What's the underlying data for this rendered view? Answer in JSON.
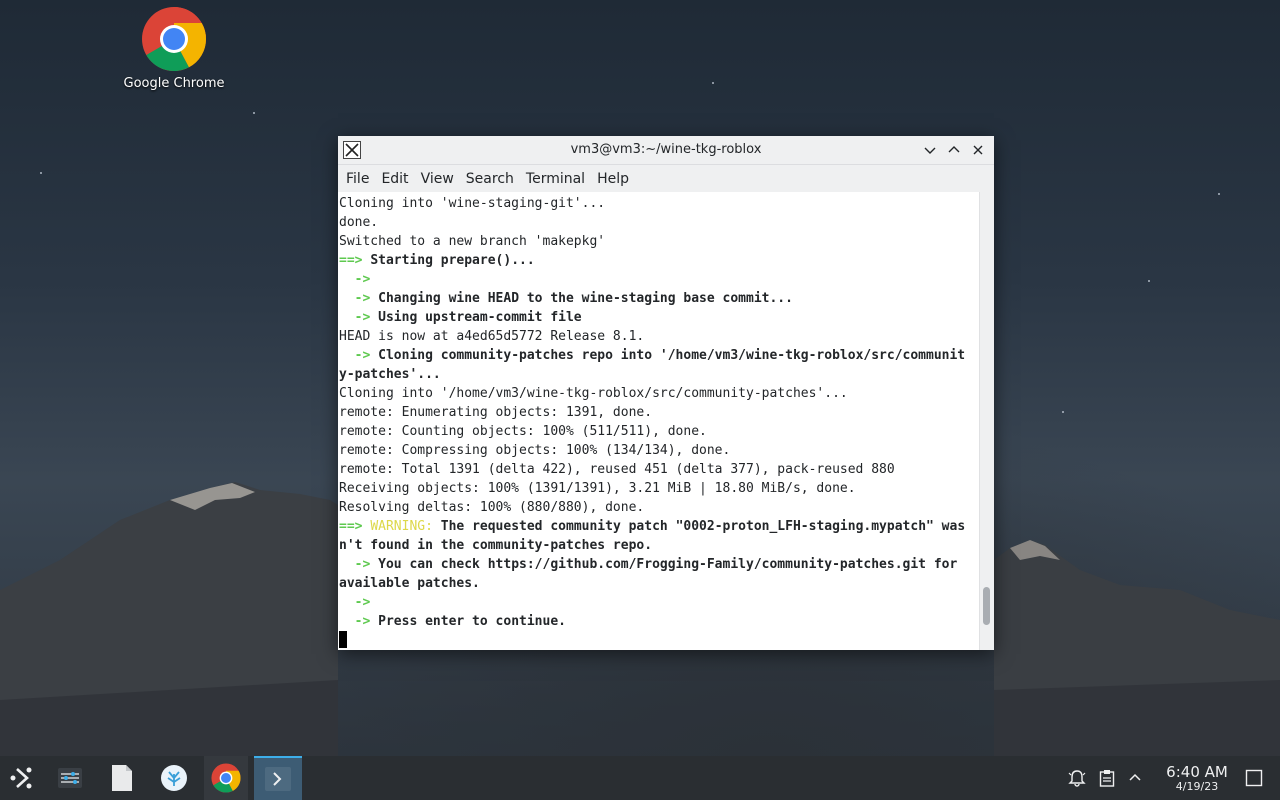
{
  "desktop": {
    "icons": [
      {
        "label": "Google Chrome",
        "icon": "chrome-icon"
      }
    ]
  },
  "window": {
    "title": "vm3@vm3:~/wine-tkg-roblox",
    "menu": [
      "File",
      "Edit",
      "View",
      "Search",
      "Terminal",
      "Help"
    ],
    "buttons": [
      "minimize-icon",
      "maximize-icon",
      "close-icon"
    ]
  },
  "terminal": {
    "lines": [
      "Cloning into 'wine-staging-git'...",
      "done.",
      "Switched to a new branch 'makepkg'",
      "Starting prepare()...",
      "  -> Changing wine HEAD to the wine-staging base commit...",
      "  -> Using upstream-commit file",
      "HEAD is now at a4ed65d5772 Release 8.1.",
      "  -> Cloning community-patches repo into '/home/vm3/wine-tkg-roblox/src/communit",
      "y-patches'...",
      "Cloning into '/home/vm3/wine-tkg-roblox/src/community-patches'...",
      "remote: Enumerating objects: 1391, done.",
      "remote: Counting objects: 100% (511/511), done.",
      "remote: Compressing objects: 100% (134/134), done.",
      "remote: Total 1391 (delta 422), reused 451 (delta 377), pack-reused 880",
      "Receiving objects: 100% (1391/1391), 3.21 MiB | 18.80 MiB/s, done.",
      "Resolving deltas: 100% (880/880), done.",
      "WARNING:",
      "The requested community patch \"0002-proton_LFH-staging.mypatch\" was",
      "n't found in the community-patches repo.",
      "  -> You can check https://github.com/Frogging-Family/community-patches.git for",
      "available patches.",
      "  -> Press enter to continue."
    ],
    "arrow": "->",
    "prompt_arrow": "==>",
    "scroll_position": 0.95
  },
  "taskbar": {
    "items": [
      {
        "icon": "app-launcher-icon"
      },
      {
        "icon": "system-settings-icon"
      },
      {
        "icon": "file-icon"
      },
      {
        "icon": "discover-icon"
      },
      {
        "icon": "chrome-icon"
      },
      {
        "icon": "terminal-icon"
      }
    ],
    "tray": [
      "notifications-icon",
      "clipboard-icon",
      "tray-expand-icon"
    ],
    "clock": {
      "time": "6:40 AM",
      "date": "4/19/23"
    }
  },
  "colors": {
    "prompt_green": "#5ec94f",
    "warning_yellow": "#ddd84a",
    "taskbar_active": "#3daee9"
  }
}
